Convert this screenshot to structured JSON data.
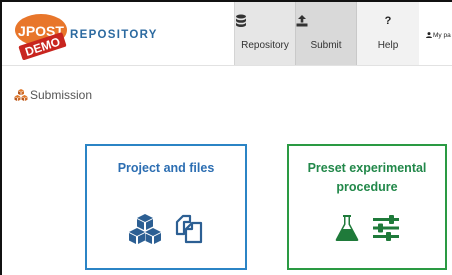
{
  "logo": {
    "text_top": "JPOST",
    "text_bottom": "DEMO"
  },
  "brand": {
    "name": "REPOSITORY"
  },
  "nav": [
    {
      "label": "Repository",
      "icon": "database-icon"
    },
    {
      "label": "Submit",
      "icon": "upload-icon"
    },
    {
      "label": "Help",
      "icon": "question-icon",
      "glyph": "?"
    }
  ],
  "user": {
    "label": "My pa",
    "icon": "user-icon"
  },
  "section": {
    "title": "Submission",
    "icon": "cubes-icon"
  },
  "cards": [
    {
      "title": "Project and files",
      "icons": [
        "cubes-icon",
        "files-icon"
      ],
      "color": "#2b84c5"
    },
    {
      "title": "Preset experimental procedure",
      "icons": [
        "flask-icon",
        "sliders-icon"
      ],
      "color": "#2a9a43"
    }
  ]
}
